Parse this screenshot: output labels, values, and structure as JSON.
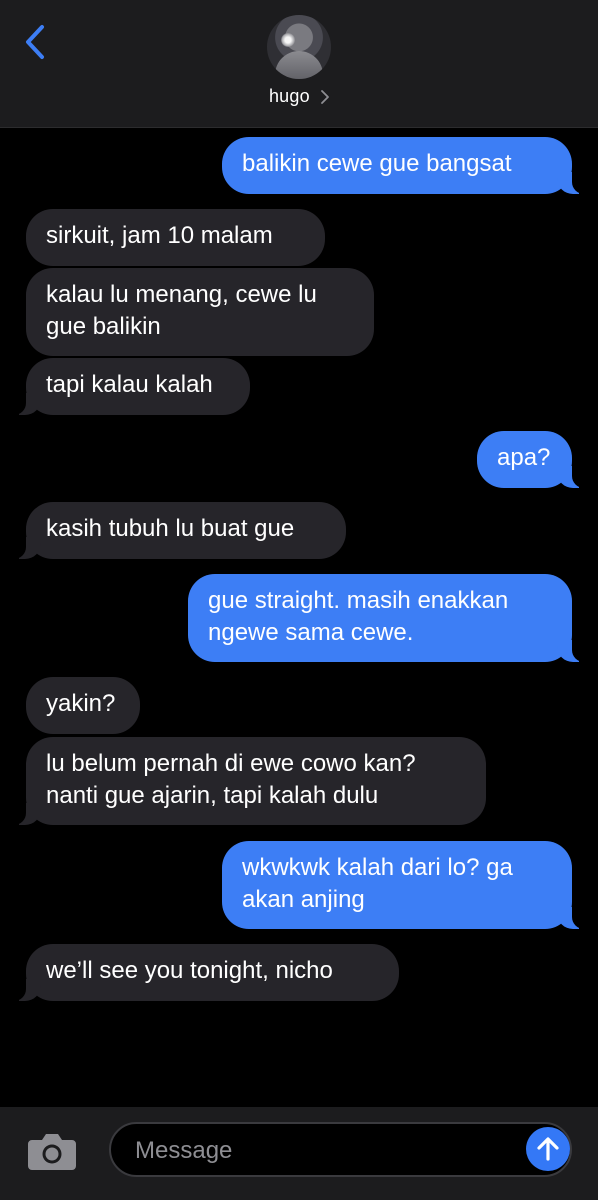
{
  "header": {
    "contact_name": "hugo",
    "back_icon": "chevron-left-icon",
    "contact_chevron_icon": "chevron-right-icon",
    "accent_color": "#3d7ef5"
  },
  "messages": [
    {
      "direction": "outgoing",
      "lines": [
        "balikin cewe gue bangsat"
      ]
    },
    {
      "direction": "incoming",
      "lines": [
        "sirkuit, jam 10 malam"
      ]
    },
    {
      "direction": "incoming",
      "lines": [
        "kalau lu menang, cewe lu",
        "gue balikin"
      ]
    },
    {
      "direction": "incoming",
      "lines": [
        "tapi kalau kalah"
      ]
    },
    {
      "direction": "outgoing",
      "lines": [
        "apa?"
      ]
    },
    {
      "direction": "incoming",
      "lines": [
        "kasih tubuh lu buat gue"
      ]
    },
    {
      "direction": "outgoing",
      "lines": [
        "gue straight. masih enakkan",
        "ngewe sama cewe."
      ]
    },
    {
      "direction": "incoming",
      "lines": [
        "yakin?"
      ]
    },
    {
      "direction": "incoming",
      "lines": [
        "lu belum pernah di ewe cowo kan?",
        "nanti gue ajarin, tapi kalah dulu"
      ]
    },
    {
      "direction": "outgoing",
      "lines": [
        "wkwkwk kalah dari lo? ga",
        "akan anjing"
      ]
    },
    {
      "direction": "incoming",
      "lines": [
        "we’ll see you tonight, nicho"
      ]
    }
  ],
  "composer": {
    "placeholder": "Message",
    "camera_icon": "camera-icon",
    "send_icon": "arrow-up-icon"
  }
}
